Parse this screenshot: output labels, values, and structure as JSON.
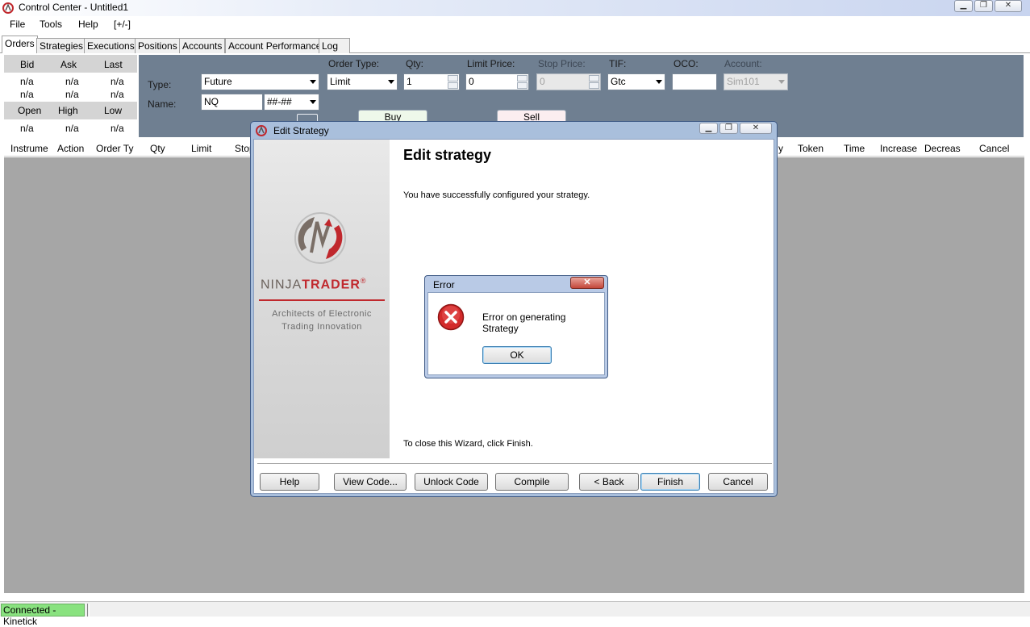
{
  "window": {
    "title": "Control Center - Untitled1"
  },
  "menu": [
    "File",
    "Tools",
    "Help",
    "[+/-]"
  ],
  "tabs": [
    "Orders",
    "Strategies",
    "Executions",
    "Positions",
    "Accounts",
    "Account Performance",
    "Log"
  ],
  "quotes": {
    "row1_headers": [
      "Bid",
      "Ask",
      "Last"
    ],
    "row1_values": [
      [
        "n/a",
        "n/a",
        "n/a"
      ],
      [
        "n/a",
        "n/a",
        "n/a"
      ]
    ],
    "row2_headers": [
      "Open",
      "High",
      "Low"
    ],
    "row2_values": [
      "n/a",
      "n/a",
      "n/a"
    ]
  },
  "order_entry": {
    "type_label": "Type:",
    "type_value": "Future",
    "name_label": "Name:",
    "name_value": "NQ",
    "expiry_value": "##-##",
    "order_type_label": "Order Type:",
    "order_type_value": "Limit",
    "qty_label": "Qty:",
    "qty_value": "1",
    "limit_label": "Limit Price:",
    "limit_value": "0",
    "stop_label": "Stop Price:",
    "stop_value": "0",
    "tif_label": "TIF:",
    "tif_value": "Gtc",
    "oco_label": "OCO:",
    "oco_value": "",
    "account_label": "Account:",
    "account_value": "Sim101",
    "buy_label": "Buy",
    "sell_label": "Sell"
  },
  "grid_headers_left": [
    "Instrume",
    "Action",
    "Order Ty",
    "Qty",
    "Limit",
    "Stop"
  ],
  "grid_headers_right": [
    "y",
    "Token",
    "Time",
    "Increase",
    "Decreas",
    "Cancel"
  ],
  "status": {
    "connection": "Connected - Kinetick"
  },
  "edit_strategy": {
    "window_title": "Edit Strategy",
    "heading": "Edit strategy",
    "message": "You have successfully configured your strategy.",
    "close_hint": "To close this Wizard, click Finish.",
    "brand_name_light": "NINJA",
    "brand_name_bold": "TRADER",
    "brand_mark": "®",
    "tagline_1": "Architects of Electronic",
    "tagline_2": "Trading Innovation",
    "buttons": {
      "help": "Help",
      "view_code": "View Code...",
      "unlock_code": "Unlock Code",
      "compile": "Compile",
      "back": "< Back",
      "finish": "Finish",
      "cancel": "Cancel"
    }
  },
  "error_dialog": {
    "title": "Error",
    "message": "Error on generating Strategy",
    "ok": "OK"
  },
  "colors": {
    "order_panel": "#6f7f91",
    "grid_background": "#a6a6a6",
    "status_connected": "#89e27f",
    "error_icon": "#d32a2a",
    "brand_red": "#c0282d"
  }
}
